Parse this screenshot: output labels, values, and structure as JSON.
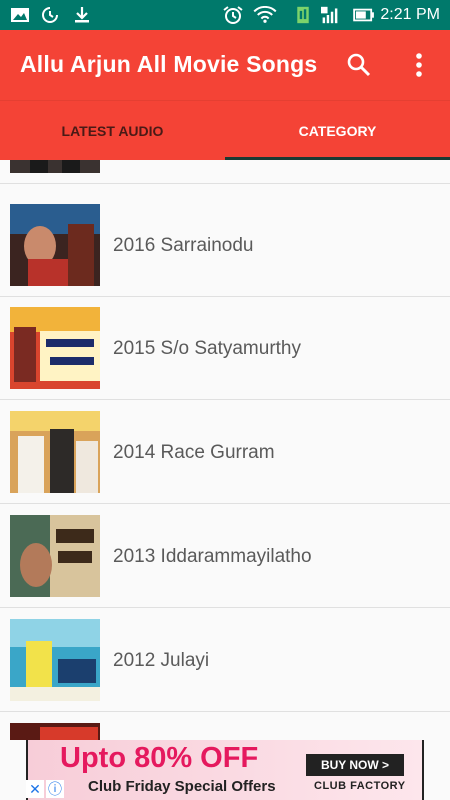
{
  "status_bar": {
    "time": "2:21 PM",
    "icons": [
      "image-icon",
      "sync-icon",
      "download-icon",
      "alarm-icon",
      "wifi-icon",
      "sim-icon",
      "signal-icon",
      "battery-icon"
    ]
  },
  "app_bar": {
    "title": "Allu Arjun All Movie Songs",
    "icons": [
      "search-icon",
      "more-vert-icon"
    ]
  },
  "tabs": [
    {
      "label": "LATEST AUDIO",
      "selected": false
    },
    {
      "label": "CATEGORY",
      "selected": true
    }
  ],
  "list": {
    "items": [
      {
        "title": ""
      },
      {
        "title": "2016 Sarrainodu"
      },
      {
        "title": "2015 S/o Satyamurthy"
      },
      {
        "title": "2014 Race Gurram"
      },
      {
        "title": "2013 Iddarammayilatho"
      },
      {
        "title": "2012 Julayi"
      },
      {
        "title": ""
      }
    ]
  },
  "ad": {
    "headline": "Upto 80% OFF",
    "subline": "Club Friday Special Offers",
    "button": "BUY NOW >",
    "brand": "CLUB FACTORY"
  },
  "colors": {
    "status_bar": "#00796b",
    "app_bar": "#f44336",
    "accent": "#1b3a33"
  }
}
